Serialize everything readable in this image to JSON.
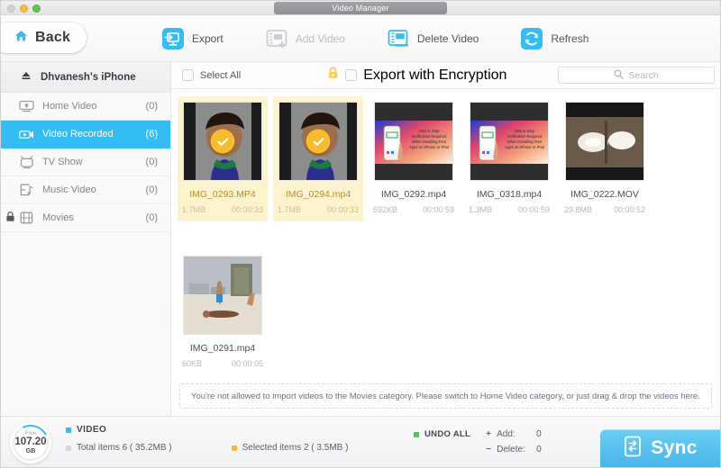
{
  "window": {
    "tab_title": "Video Manager",
    "traffic_lights": [
      "close-button",
      "minimize-button",
      "maximize-button"
    ]
  },
  "toolbar": {
    "back_label": "Back",
    "back_icon": "home-icon",
    "actions": [
      {
        "label": "Export",
        "icon": "export-icon",
        "enabled": true
      },
      {
        "label": "Add Video",
        "icon": "add-video-icon",
        "enabled": false
      },
      {
        "label": "Delete Video",
        "icon": "delete-video-icon",
        "enabled": true
      },
      {
        "label": "Refresh",
        "icon": "refresh-icon",
        "enabled": true
      }
    ]
  },
  "sidebar": {
    "device_name": "Dhvanesh's iPhone",
    "device_icon": "eject-icon",
    "items": [
      {
        "label": "Home Video",
        "count": "(0)",
        "icon": "home-video-icon",
        "active": false,
        "locked": false
      },
      {
        "label": "Video Recorded",
        "count": "(6)",
        "icon": "video-recorded-icon",
        "active": true,
        "locked": false
      },
      {
        "label": "TV Show",
        "count": "(0)",
        "icon": "tv-show-icon",
        "active": false,
        "locked": false
      },
      {
        "label": "Music Video",
        "count": "(0)",
        "icon": "music-video-icon",
        "active": false,
        "locked": false
      },
      {
        "label": "Movies",
        "count": "(0)",
        "icon": "movies-icon",
        "active": false,
        "locked": true
      }
    ]
  },
  "content_header": {
    "select_all_label": "Select All",
    "select_all_checked": false,
    "encryption_label": "Export with Encryption",
    "encryption_checked": false,
    "encryption_icon": "lock-icon",
    "search_placeholder": "Search",
    "search_value": "",
    "search_icon": "search-icon"
  },
  "videos": [
    {
      "name": "IMG_0293.MP4",
      "size": "1.7MB",
      "duration": "00:00:33",
      "selected": true,
      "thumb": "portrait-man-blue-shirt"
    },
    {
      "name": "IMG_0294.mp4",
      "size": "1.7MB",
      "duration": "00:00:33",
      "selected": true,
      "thumb": "portrait-man-blue-shirt"
    },
    {
      "name": "IMG_0292.mp4",
      "size": "592KB",
      "duration": "00:00:59",
      "selected": false,
      "thumb": "iphone-tutorial-card"
    },
    {
      "name": "IMG_0318.mp4",
      "size": "1.3MB",
      "duration": "00:00:59",
      "selected": false,
      "thumb": "iphone-tutorial-card"
    },
    {
      "name": "IMG_0222.MOV",
      "size": "29.8MB",
      "duration": "00:00:52",
      "selected": false,
      "thumb": "dark-blurry-indoor"
    },
    {
      "name": "IMG_0291.mp4",
      "size": "60KB",
      "duration": "00:00:05",
      "selected": false,
      "thumb": "beach-scene"
    }
  ],
  "notice": "You're not allowed to  import videos to the Movies category. Please switch to Home Video category, or just drag & drop the videos here.",
  "status_bar": {
    "storage": {
      "free_label": "Free",
      "value": "107.20",
      "unit": "GB"
    },
    "section_title": "VIDEO",
    "total_items": "Total items 6 ( 35.2MB )",
    "selected_items": "Selected items 2 ( 3.5MB )",
    "undo_all": "UNDO ALL",
    "add_label": "Add:",
    "add_value": "0",
    "delete_label": "Delete:",
    "delete_value": "0",
    "sync_label": "Sync",
    "sync_icon": "sync-device-icon"
  },
  "colors": {
    "accent_blue": "#33bdf2",
    "selected_yellow": "#fdf3cf",
    "check_yellow": "#f6bc2d",
    "undo_green": "#4ec45a",
    "sync_blue": "#46b7e8"
  }
}
